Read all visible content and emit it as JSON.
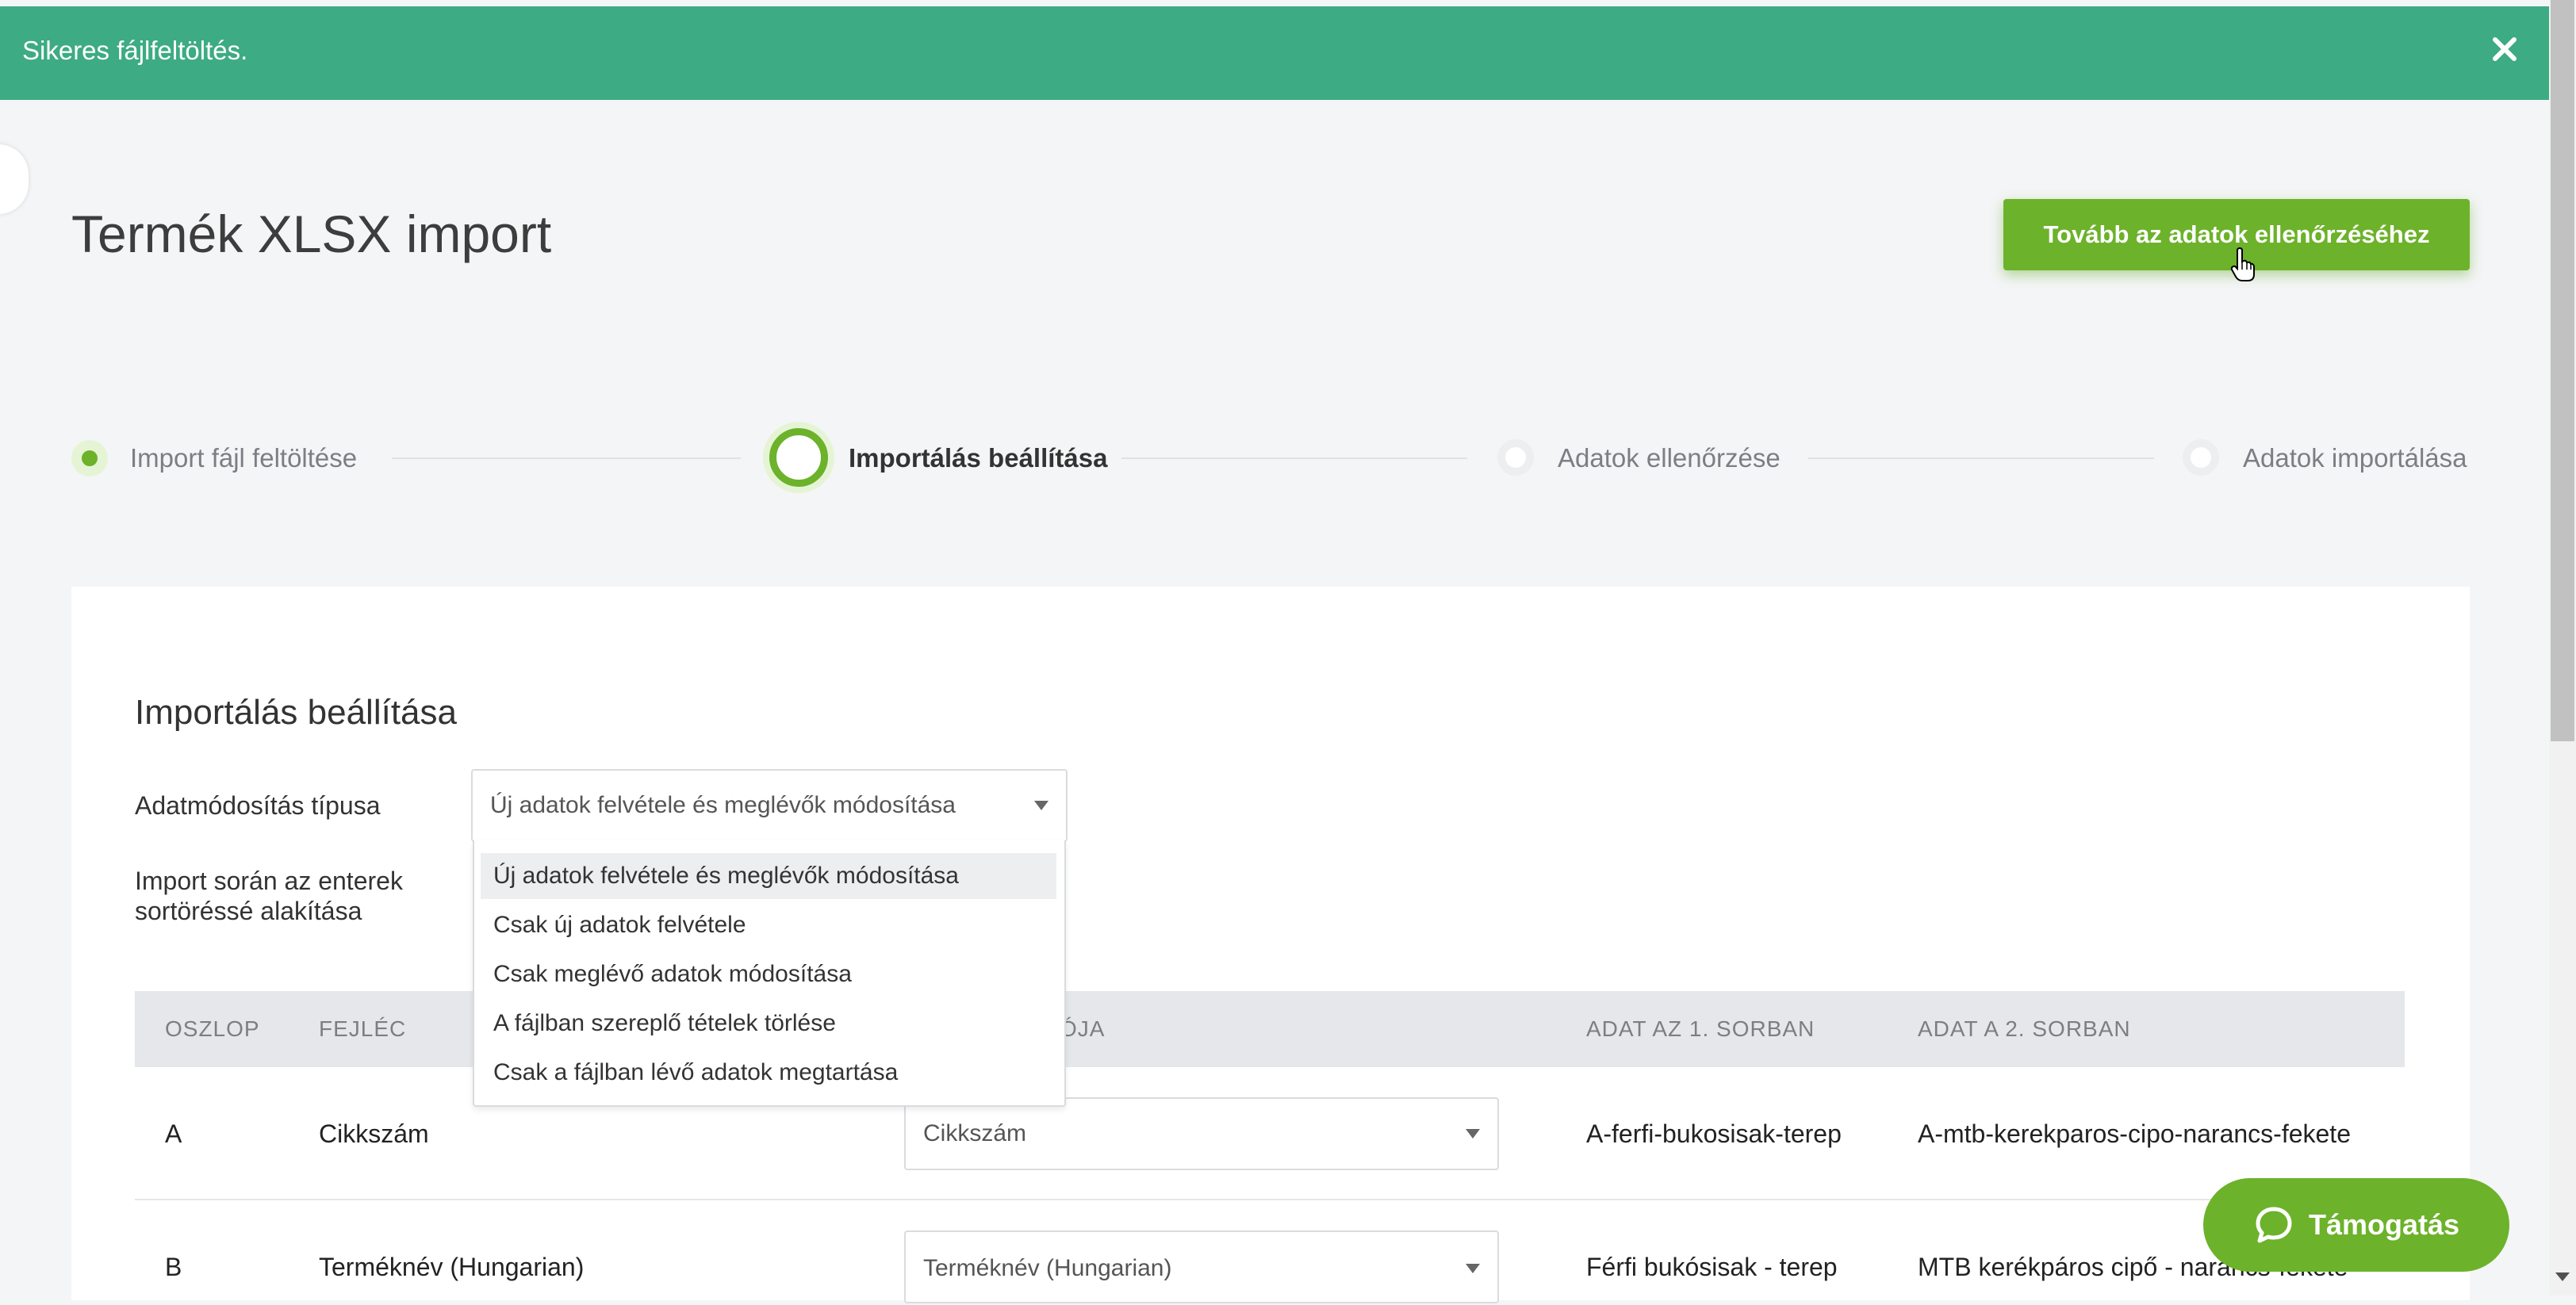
{
  "banner": {
    "message": "Sikeres fájlfeltöltés.",
    "close_icon": "close-icon",
    "color": "#3dab83"
  },
  "page": {
    "title": "Termék XLSX import",
    "next_button": "Tovább az adatok ellenőrzéséhez"
  },
  "steps": [
    {
      "label": "Import fájl feltöltése",
      "state": "done"
    },
    {
      "label": "Importálás beállítása",
      "state": "active"
    },
    {
      "label": "Adatok ellenőrzése",
      "state": "pending"
    },
    {
      "label": "Adatok importálása",
      "state": "pending"
    }
  ],
  "settings": {
    "title": "Importálás beállítása",
    "modify_type_label": "Adatmódosítás típusa",
    "modify_type_value": "Új adatok felvétele és meglévők módosítása",
    "enter_label_line1": "Import során az enterek",
    "enter_label_line2": "sortöréssé alakítása",
    "dropdown_options": [
      "Új adatok felvétele és meglévők módosítása",
      "Csak új adatok felvétele",
      "Csak meglévő adatok módosítása",
      "A fájlban szereplő tételek törlése",
      "Csak a fájlban lévő adatok megtartása"
    ]
  },
  "table": {
    "headers": [
      "OSZLOP",
      "FEJLÉC",
      "CIÓJA",
      "ADAT AZ 1. SORBAN",
      "ADAT A 2. SORBAN"
    ],
    "rows": [
      {
        "col": "A",
        "header": "Cikkszám",
        "mapping": "Cikkszám",
        "row1": "A-ferfi-bukosisak-terep",
        "row2": "A-mtb-kerekparos-cipo-narancs-fekete"
      },
      {
        "col": "B",
        "header": "Terméknév (Hungarian)",
        "mapping": "Terméknév (Hungarian)",
        "row1": "Férfi bukósisak - terep",
        "row2": "MTB kerékpáros cipő - narancs-fekete"
      }
    ]
  },
  "support": {
    "label": "Támogatás",
    "icon": "chat-bubble-icon"
  },
  "colors": {
    "accent": "#6cb22a",
    "banner": "#3dab83"
  }
}
